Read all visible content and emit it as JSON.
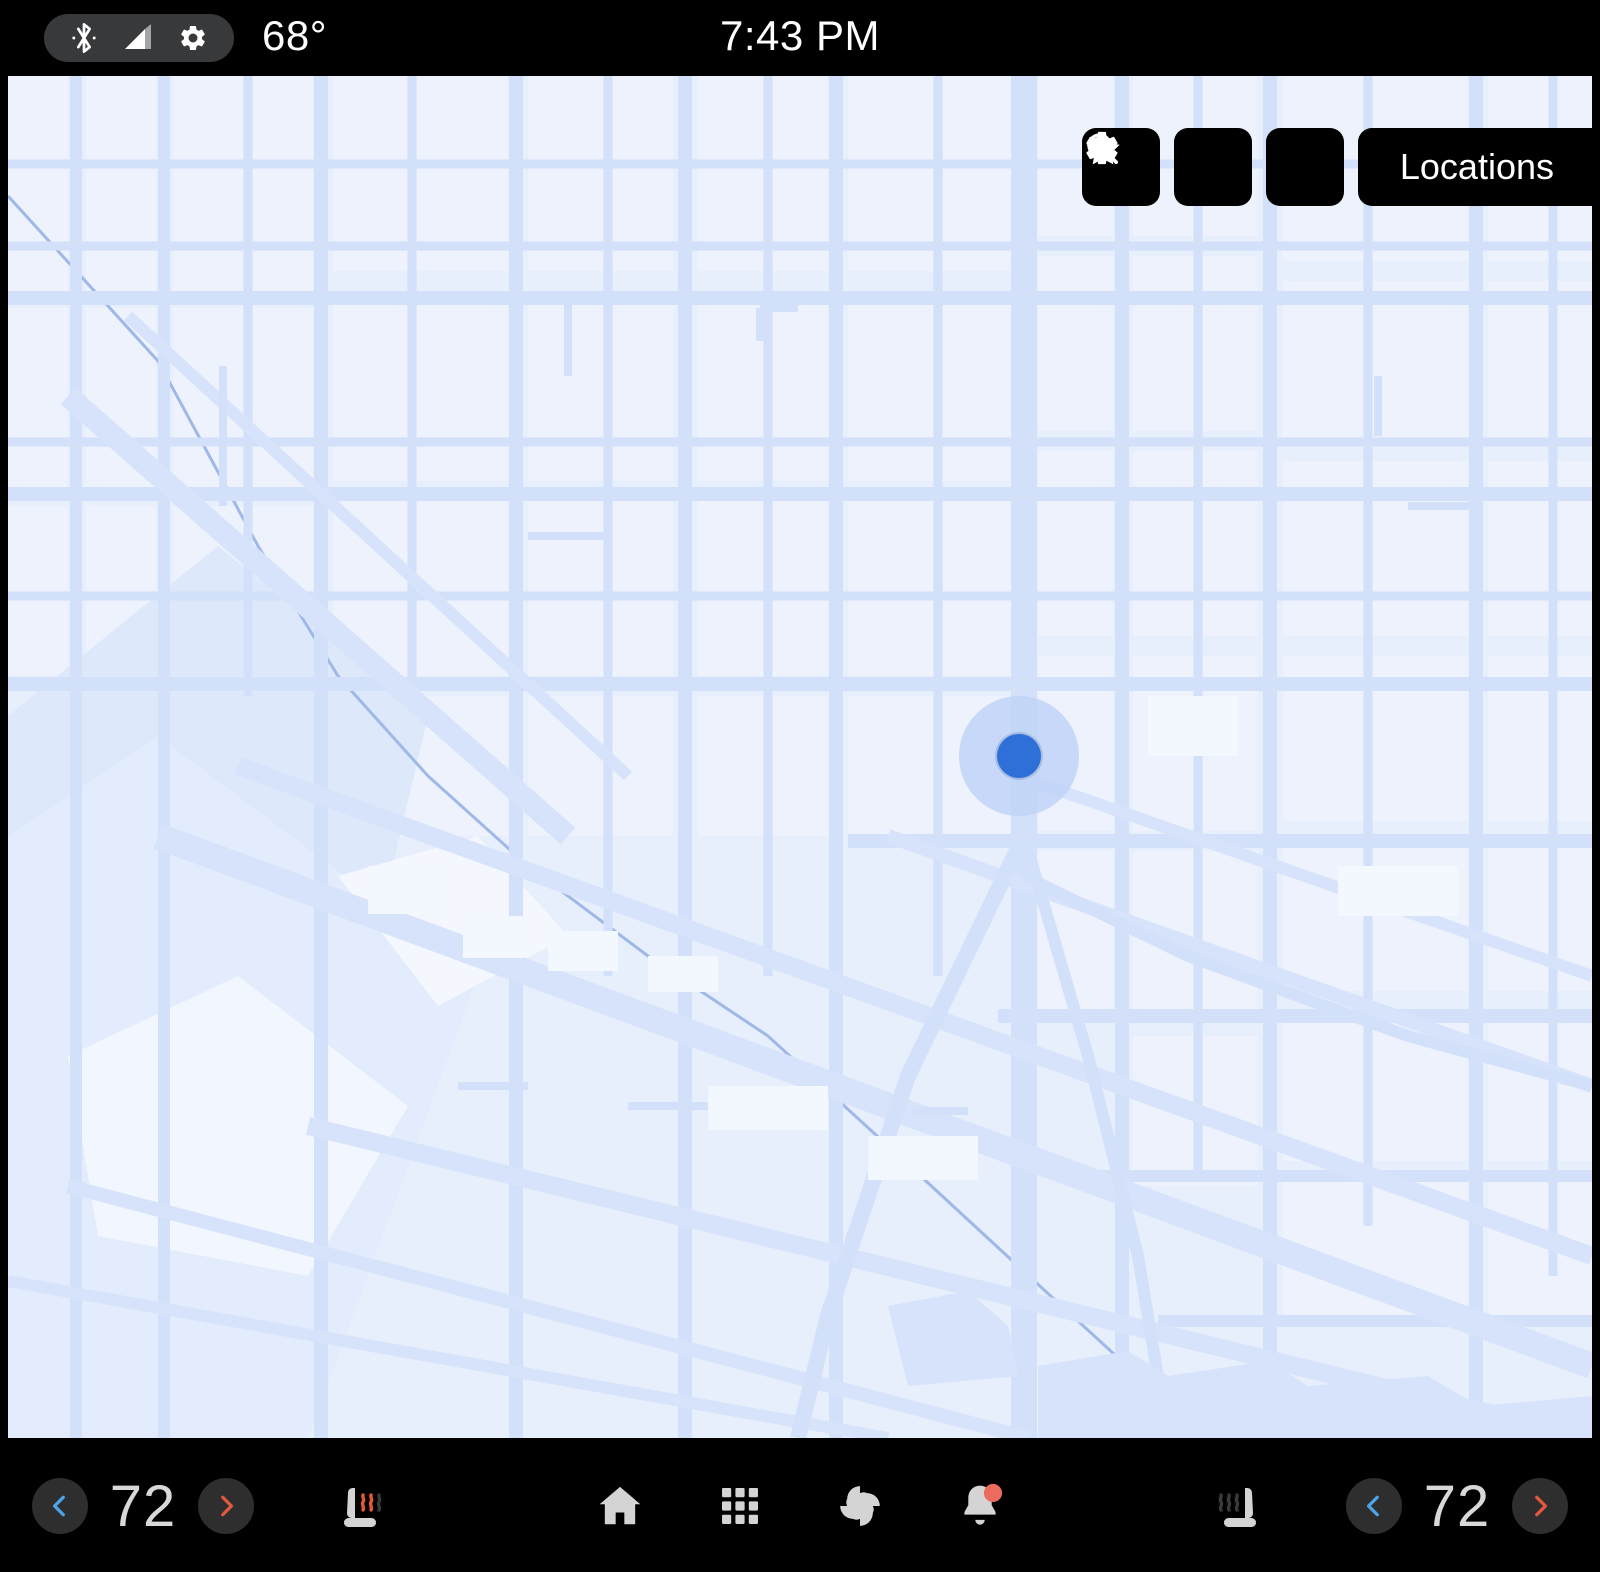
{
  "status_bar": {
    "icons": [
      "bluetooth-icon",
      "cell-signal-icon",
      "gear-icon"
    ],
    "temperature": "68°",
    "clock": "7:43 PM"
  },
  "map": {
    "toolbar": {
      "search_label": "search-icon",
      "settings_label": "gear-icon",
      "favorites_label": "star-icon",
      "locations_label": "Locations"
    },
    "marker": {
      "type": "current-location-puck",
      "dot_color": "#2f6fd8",
      "halo_color": "#bfd4f7"
    },
    "colors": {
      "base": "#e7eefc",
      "block": "#edf2fd",
      "road": "#d2e0f9",
      "water": "#dfe9fb",
      "river_line": "#9fb8e8"
    }
  },
  "bottom_bar": {
    "left_climate": {
      "decrease_label": "‹",
      "temperature": "72",
      "increase_label": "›",
      "seat_icon": "heated-seat-left-icon",
      "seat_state": "on"
    },
    "right_climate": {
      "seat_icon": "heated-seat-right-icon",
      "seat_state": "off",
      "decrease_label": "‹",
      "temperature": "72",
      "increase_label": "›"
    },
    "nav": [
      {
        "name": "home-icon",
        "label": "Home"
      },
      {
        "name": "apps-grid-icon",
        "label": "Apps"
      },
      {
        "name": "fan-icon",
        "label": "Climate"
      },
      {
        "name": "bell-icon",
        "label": "Notifications",
        "badge": true
      }
    ],
    "colors": {
      "decrease": "#4da3e8",
      "increase": "#e2583f",
      "temp_text": "#d8d8d8",
      "icon": "#d4d4d4",
      "badge": "#eb6b5e",
      "circle_bg": "#2e2e2e"
    }
  }
}
